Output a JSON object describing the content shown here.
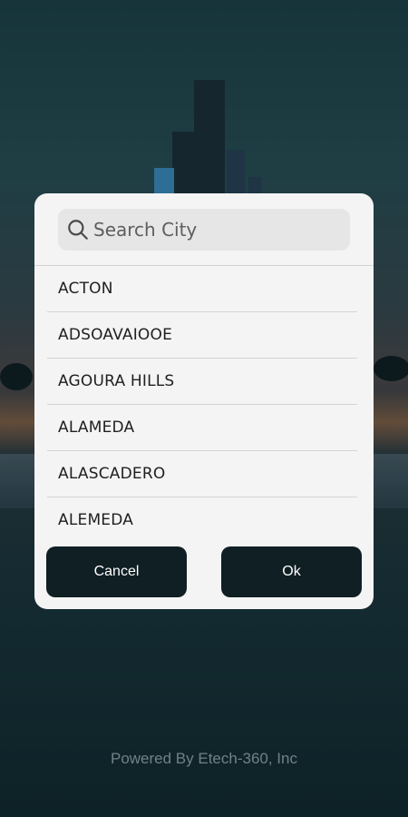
{
  "search": {
    "placeholder": "Search City",
    "icon": "search-icon"
  },
  "cities": [
    "ACTON",
    "ADSOAVAIOOE",
    "AGOURA HILLS",
    "ALAMEDA",
    "ALASCADERO",
    "ALEMEDA"
  ],
  "buttons": {
    "cancel_label": "Cancel",
    "ok_label": "Ok"
  },
  "footer": {
    "text": "Powered By Etech-360, Inc"
  },
  "colors": {
    "button_bg": "#0f1f24",
    "dialog_bg": "#f4f4f4",
    "search_bg": "#e6e6e6"
  }
}
